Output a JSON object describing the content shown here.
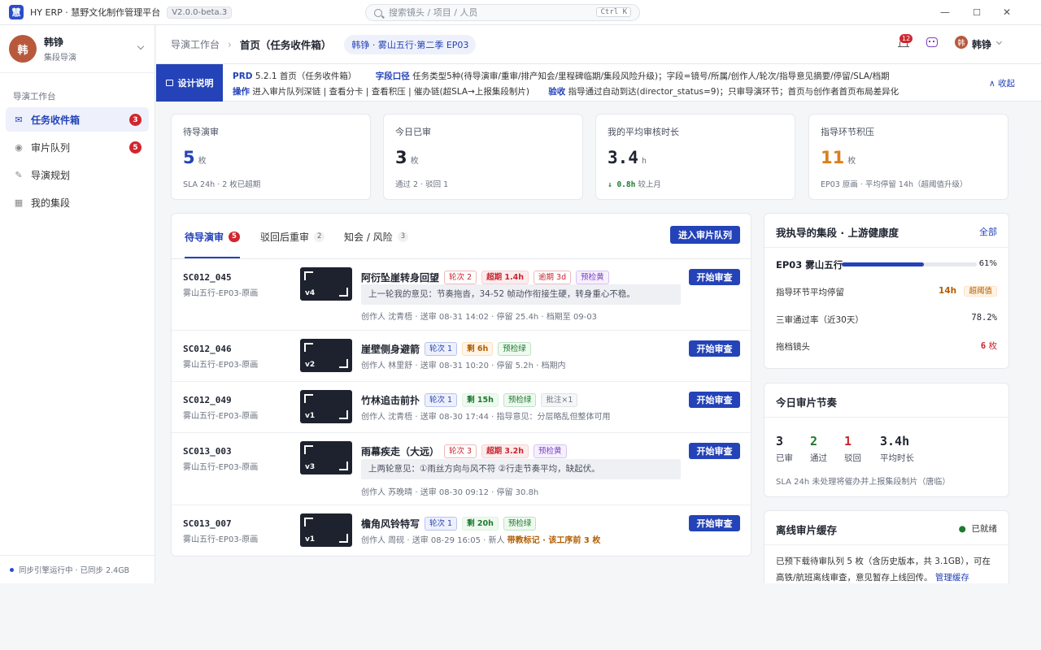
{
  "app": {
    "name": "HY ERP · 慧野文化制作管理平台",
    "version": "V2.0.0-beta.3",
    "logo_char": "慧"
  },
  "search": {
    "placeholder": "搜索镜头 / 项目 / 人员",
    "shortcut": "Ctrl K"
  },
  "window": {
    "min": "—",
    "max": "☐",
    "close": "✕"
  },
  "user": {
    "avatar": "韩",
    "name": "韩铮",
    "role": "集段导演"
  },
  "sidebar": {
    "section": "导演工作台",
    "items": [
      {
        "label": "任务收件箱",
        "badge": "3",
        "icon": "✉"
      },
      {
        "label": "审片队列",
        "badge": "5",
        "icon": "◉"
      },
      {
        "label": "导演规划",
        "icon": "✎"
      },
      {
        "label": "我的集段",
        "icon": "▦"
      }
    ],
    "sync": "同步引擎运行中 · 已同步 2.4GB"
  },
  "header": {
    "crumb_parent": "导演工作台",
    "crumb_sep": "›",
    "title": "首页（任务收件箱）",
    "context": "韩铮 · 雾山五行·第二季 EP03",
    "notif_count": "12",
    "user_avatar": "韩",
    "user_name": "韩铮"
  },
  "design": {
    "label": "设计说明",
    "r1_k1": "PRD",
    "r1_v1": "5.2.1 首页（任务收件箱）",
    "r1_k2": "字段口径",
    "r1_v2": "任务类型5种(待导演审/重审/排产知会/里程碑临期/集段风险升级)；字段=镜号/所属/创作人/轮次/指导意见摘要/停留/SLA/档期",
    "r2_k1": "操作",
    "r2_v1": "进入审片队列深链 | 查看分卡 | 查看积压 | 催办链(超SLA→上报集段制片)",
    "r2_k2": "验收",
    "r2_v2": "指导通过自动到达(director_status=9)；只审导演环节；首页与创作者首页布局差异化",
    "collapse": "∧ 收起"
  },
  "stats": [
    {
      "title": "待导演审",
      "value": "5",
      "unit": "枚",
      "sub": "SLA 24h · 2 枚已超期",
      "color": "#2443b8"
    },
    {
      "title": "今日已审",
      "value": "3",
      "unit": "枚",
      "sub": "通过 2 · 驳回 1",
      "color": "#1f2430"
    },
    {
      "title": "我的平均审核时长",
      "value": "3.4",
      "unit": "h",
      "sub_strong": "↓ 0.8h",
      "sub": "较上月",
      "color": "#1f2430"
    },
    {
      "title": "指导环节积压",
      "value": "11",
      "unit": "枚",
      "sub": "EP03 原画 · 平均停留 14h（超阈值升级）",
      "color": "#d9801e"
    }
  ],
  "tabs": [
    {
      "label": "待导演审",
      "count": "5"
    },
    {
      "label": "驳回后重审",
      "count": "2"
    },
    {
      "label": "知会 / 风险",
      "count": "3"
    }
  ],
  "enter_queue": "进入审片队列",
  "start_label": "开始审查",
  "tasks": [
    {
      "code": "SC012_045",
      "sub": "雾山五行-EP03-原画",
      "ver": "v4",
      "title": "阿衍坠崖转身回望",
      "tags": [
        {
          "t": "轮次 2",
          "c": "red"
        },
        {
          "t": "超期 1.4h",
          "c": "redf"
        },
        {
          "t": "逾期 3d",
          "c": "red"
        },
        {
          "t": "预检黄",
          "c": "purp"
        }
      ],
      "note": "上一轮我的意见：节奏拖沓，34-52 帧动作衔接生硬，转身重心不稳。",
      "meta": "创作人 沈青梧 · 送审 08-31 14:02 · 停留 25.4h · 档期至 09-03"
    },
    {
      "code": "SC012_046",
      "sub": "雾山五行-EP03-原画",
      "ver": "v2",
      "title": "崖壁侧身避箭",
      "tags": [
        {
          "t": "轮次 1",
          "c": "blue"
        },
        {
          "t": "剩 6h",
          "c": "orng"
        },
        {
          "t": "预检绿",
          "c": "green"
        }
      ],
      "meta": "创作人 林里舒 · 送审 08-31 10:20 · 停留 5.2h · 档期内"
    },
    {
      "code": "SC012_049",
      "sub": "雾山五行-EP03-原画",
      "ver": "v1",
      "title": "竹林追击前扑",
      "tags": [
        {
          "t": "轮次 1",
          "c": "blue"
        },
        {
          "t": "剩 15h",
          "c": "greenf"
        },
        {
          "t": "预检绿",
          "c": "green"
        },
        {
          "t": "批注×1",
          "c": "gray"
        }
      ],
      "meta": "创作人 沈青梧 · 送审 08-30 17:44 · 指导意见：分层略乱但整体可用"
    },
    {
      "code": "SC013_003",
      "sub": "雾山五行-EP03-原画",
      "ver": "v3",
      "title": "雨幕疾走（大远）",
      "tags": [
        {
          "t": "轮次 3",
          "c": "red"
        },
        {
          "t": "超期 3.2h",
          "c": "redf"
        },
        {
          "t": "预检黄",
          "c": "purp"
        }
      ],
      "note": "上两轮意见：①雨丝方向与风不符 ②行走节奏平均，缺起伏。",
      "meta": "创作人 苏晚晴 · 送审 08-30 09:12 · 停留 30.8h"
    },
    {
      "code": "SC013_007",
      "sub": "雾山五行-EP03-原画",
      "ver": "v1",
      "title": "檐角风铃特写",
      "tags": [
        {
          "t": "轮次 1",
          "c": "blue"
        },
        {
          "t": "剩 20h",
          "c": "greenf"
        },
        {
          "t": "预检绿",
          "c": "green"
        }
      ],
      "meta": "创作人 周砚 · 送审 08-29 16:05 · 新人",
      "meta_warn": "带教标记 · 该工序前 3 枚"
    }
  ],
  "health": {
    "title": "我执导的集段 · 上游健康度",
    "link": "全部",
    "ep": "EP03 雾山五行",
    "progress": 0.61,
    "progress_label": "61%",
    "r1_label": "指导环节平均停留",
    "r1_value": "14h",
    "r1_tag": "超阈值",
    "r2_label": "三审通过率（近30天）",
    "r2_value": "78.2%",
    "r3_label": "拖档镜头",
    "r3_value": "6",
    "r3_unit": "枚"
  },
  "rhythm": {
    "title": "今日审片节奏",
    "stats": [
      {
        "n": "3",
        "l": "已审",
        "color": "#1f2430"
      },
      {
        "n": "2",
        "l": "通过",
        "color": "#1e7a2f"
      },
      {
        "n": "1",
        "l": "驳回",
        "color": "#c8262e"
      },
      {
        "n": "3.4h",
        "l": "平均时长",
        "color": "#1f2430"
      }
    ],
    "note": "SLA 24h 未处理将催办并上报集段制片（唐临）"
  },
  "offline": {
    "title": "离线审片缓存",
    "status": "已就绪",
    "text1": "已预下载待审队列 5 枚（含历史版本，共 3.1GB），可在",
    "text2": "高铁/航班离线审查，意见暂存上线回传。",
    "link": "管理缓存"
  }
}
